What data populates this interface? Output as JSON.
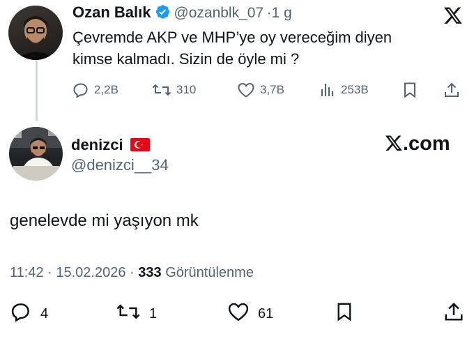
{
  "quoted_tweet": {
    "author_name": "Ozan Balık",
    "author_handle": "@ozanblk_07",
    "age": "1 g",
    "text_line1": "Çevremde AKP ve MHP’ye oy vereceğim diyen",
    "text_line2": "kimse kalmadı. Sizin de öyle mi ?",
    "replies": "2,2B",
    "reposts": "310",
    "likes": "3,7B",
    "views": "253B"
  },
  "reply_tweet": {
    "author_name": "denizci",
    "author_handle": "@denizci__34",
    "text": "genelevde mi yaşıyon mk",
    "time": "11:42",
    "date": "15.02.2026",
    "views_count": "333",
    "views_label": "Görüntülenme",
    "replies": "4",
    "reposts": "1",
    "likes": "61"
  },
  "brand": {
    "watermark": "X.com",
    "verified_color": "#1d9bf0",
    "flag_color": "#e30a17"
  }
}
